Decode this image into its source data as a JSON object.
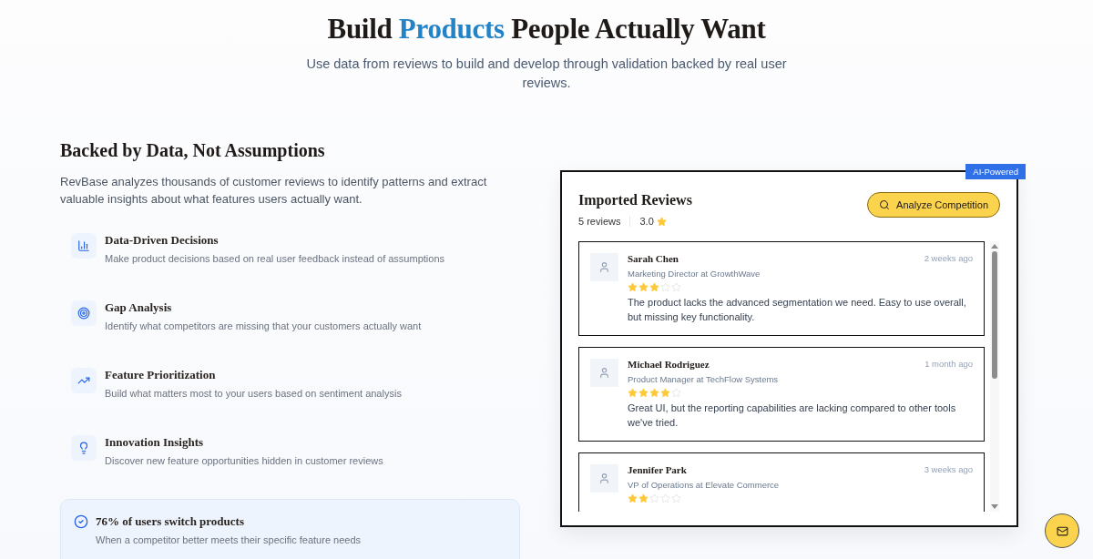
{
  "hero": {
    "headline": [
      {
        "text": "Build",
        "highlight": false
      },
      {
        "text": "Products",
        "highlight": true
      },
      {
        "text": "People Actually Want",
        "highlight": false
      }
    ],
    "subtitle": "Use data from reviews to build and develop through validation backed by real user reviews."
  },
  "benefits": {
    "title": "Backed by Data, Not Assumptions",
    "intro": "RevBase analyzes thousands of customer reviews to identify patterns and extract valuable insights about what features users actually want.",
    "features": [
      {
        "kind": "chart",
        "title": "Data-Driven Decisions",
        "text": "Make product decisions based on real user feedback instead of assumptions"
      },
      {
        "kind": "target",
        "title": "Gap Analysis",
        "text": "Identify what competitors are missing that your customers actually want"
      },
      {
        "kind": "trend",
        "title": "Feature Prioritization",
        "text": "Build what matters most to your users based on sentiment analysis"
      },
      {
        "kind": "idea",
        "title": "Innovation Insights",
        "text": "Discover new feature opportunities hidden in customer reviews"
      }
    ],
    "stat": {
      "title": "76% of users switch products",
      "text": "When a competitor better meets their specific feature needs"
    }
  },
  "reviews_panel": {
    "badge": "AI-Powered",
    "title": "Imported Reviews",
    "count": "5 reviews",
    "rating": "3.0",
    "button": "Analyze Competition",
    "reviews": [
      {
        "name": "Sarah Chen",
        "role": "Marketing Director at GrowthWave",
        "time": "2 weeks ago",
        "stars": 3,
        "text": "The product lacks the advanced segmentation we need. Easy to use overall, but missing key functionality."
      },
      {
        "name": "Michael Rodriguez",
        "role": "Product Manager at TechFlow Systems",
        "time": "1 month ago",
        "stars": 4,
        "text": "Great UI, but the reporting capabilities are lacking compared to other tools we've tried."
      },
      {
        "name": "Jennifer Park",
        "role": "VP of Operations at Elevate Commerce",
        "time": "3 weeks ago",
        "stars": 2
      }
    ]
  }
}
